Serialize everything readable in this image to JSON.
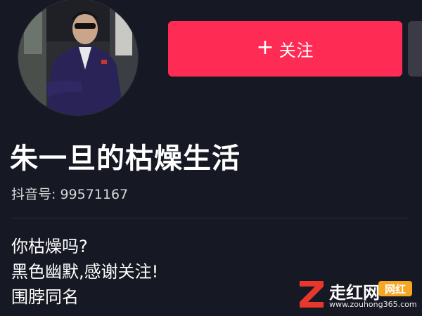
{
  "profile": {
    "nickname": "朱一旦的枯燥生活",
    "douyin_id": "抖音号: 99571167",
    "follow_label": "关注",
    "avatar_desc": "avatar"
  },
  "bio": {
    "lines": [
      "你枯燥吗?",
      "黑色幽默,感谢关注!",
      "围脖同名"
    ]
  },
  "watermark": {
    "title": "走红网",
    "badge": "网红",
    "url": "www.zouhong365.com"
  },
  "colors": {
    "background": "#161823",
    "follow_button": "#fe2c55",
    "watermark_logo": "#e8382d",
    "watermark_badge": "#f5a623"
  },
  "icons": {
    "follow": "plus-icon",
    "watermark_logo": "z-logo-icon"
  }
}
